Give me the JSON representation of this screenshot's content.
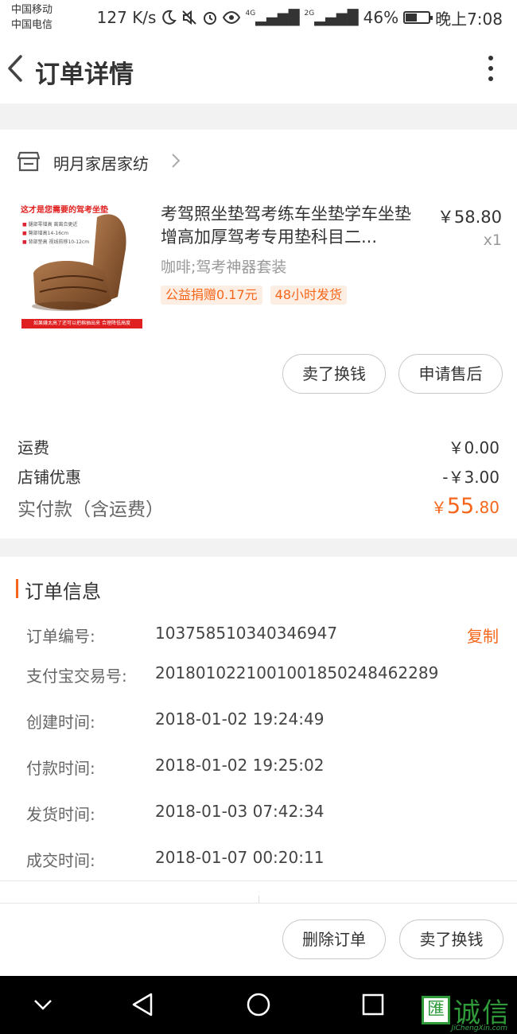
{
  "status_bar": {
    "carrier1": "中国移动",
    "carrier2": "中国电信",
    "net_speed": "127 K/s",
    "signal1_label": "4G",
    "signal2_label": "2G",
    "battery": "46%",
    "time": "晚上7:08"
  },
  "header": {
    "title": "订单详情"
  },
  "shop": {
    "name": "明月家居家纺"
  },
  "product": {
    "image_caption": "这才是您需要的驾考坐垫",
    "image_bullets": [
      "腿部零增高 离离合更近",
      "臀部增高14-16cm",
      "背部垫高 视线前移10-12cm"
    ],
    "image_footer": "如果嫌太高了还可以把棉抽出来 合理降低高度",
    "title": "考驾照坐垫驾考练车坐垫学车坐垫增高加厚驾考专用垫科目二...",
    "price": "￥58.80",
    "quantity": "x1",
    "spec": "咖啡;驾考神器套装",
    "tags": [
      "公益捐赠0.17元",
      "48小时发货"
    ]
  },
  "item_actions": {
    "sell": "卖了换钱",
    "after_sale": "申请售后"
  },
  "fees": {
    "shipping_label": "运费",
    "shipping_value": "￥0.00",
    "discount_label": "店铺优惠",
    "discount_value": "-￥3.00",
    "paid_label": "实付款（含运费）",
    "paid_currency": "￥",
    "paid_int": "55",
    "paid_dec": ".80"
  },
  "order_info": {
    "title": "订单信息",
    "copy_label": "复制",
    "rows": [
      {
        "label": "订单编号:",
        "value": "103758510340346947"
      },
      {
        "label": "支付宝交易号:",
        "value": "2018010221001001850248462289"
      },
      {
        "label": "创建时间:",
        "value": "2018-01-02 19:24:49"
      },
      {
        "label": "付款时间:",
        "value": "2018-01-02 19:25:02"
      },
      {
        "label": "发货时间:",
        "value": "2018-01-03 07:42:34"
      },
      {
        "label": "成交时间:",
        "value": "2018-01-07 00:20:11"
      }
    ]
  },
  "bottom_actions": {
    "delete": "删除订单",
    "sell": "卖了换钱"
  },
  "watermark": {
    "box": "匯",
    "text": "诚信",
    "sub": "JiChengXin.com"
  },
  "colors": {
    "accent": "#f5661a",
    "text": "#333333",
    "muted": "#999999",
    "bg": "#f2f2f2"
  }
}
